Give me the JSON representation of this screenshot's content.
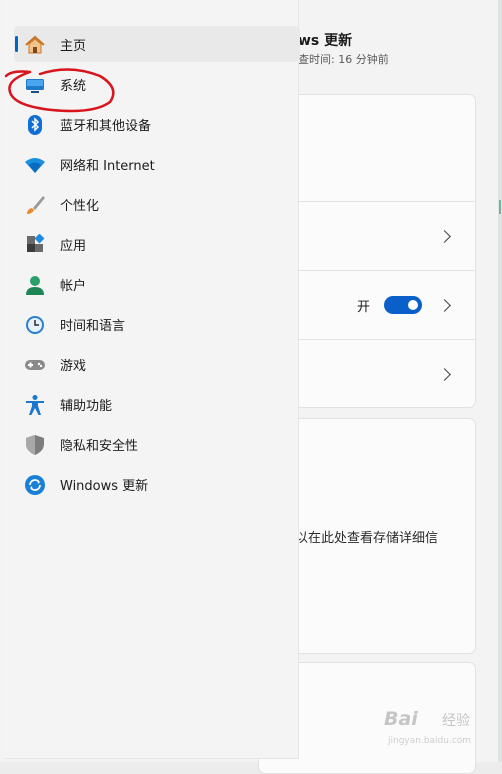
{
  "page": {
    "title": "ws 更新",
    "subtitle": "查时间: 16 分钟前"
  },
  "sidebar": {
    "items": [
      {
        "label": "主页",
        "icon": "home-icon"
      },
      {
        "label": "系统",
        "icon": "system-monitor-icon"
      },
      {
        "label": "蓝牙和其他设备",
        "icon": "bluetooth-icon"
      },
      {
        "label": "网络和 Internet",
        "icon": "wifi-icon"
      },
      {
        "label": "个性化",
        "icon": "brush-icon"
      },
      {
        "label": "应用",
        "icon": "apps-icon"
      },
      {
        "label": "帐户",
        "icon": "account-icon"
      },
      {
        "label": "时间和语言",
        "icon": "clock-globe-icon"
      },
      {
        "label": "游戏",
        "icon": "gamepad-icon"
      },
      {
        "label": "辅助功能",
        "icon": "accessibility-icon"
      },
      {
        "label": "隐私和安全性",
        "icon": "shield-icon"
      },
      {
        "label": "Windows 更新",
        "icon": "windows-update-icon"
      }
    ],
    "selected_index": 0
  },
  "main": {
    "toggle": {
      "label": "开",
      "state": "on"
    },
    "storage_text": "以在此处查看存储详细信"
  },
  "colors": {
    "accent": "#0067c0",
    "annotation": "#d8141c",
    "toggle_on": "#0a60c8"
  },
  "watermark": {
    "logo": "Bai",
    "jingyan": "经验",
    "url": "jingyan.baidu.com"
  }
}
